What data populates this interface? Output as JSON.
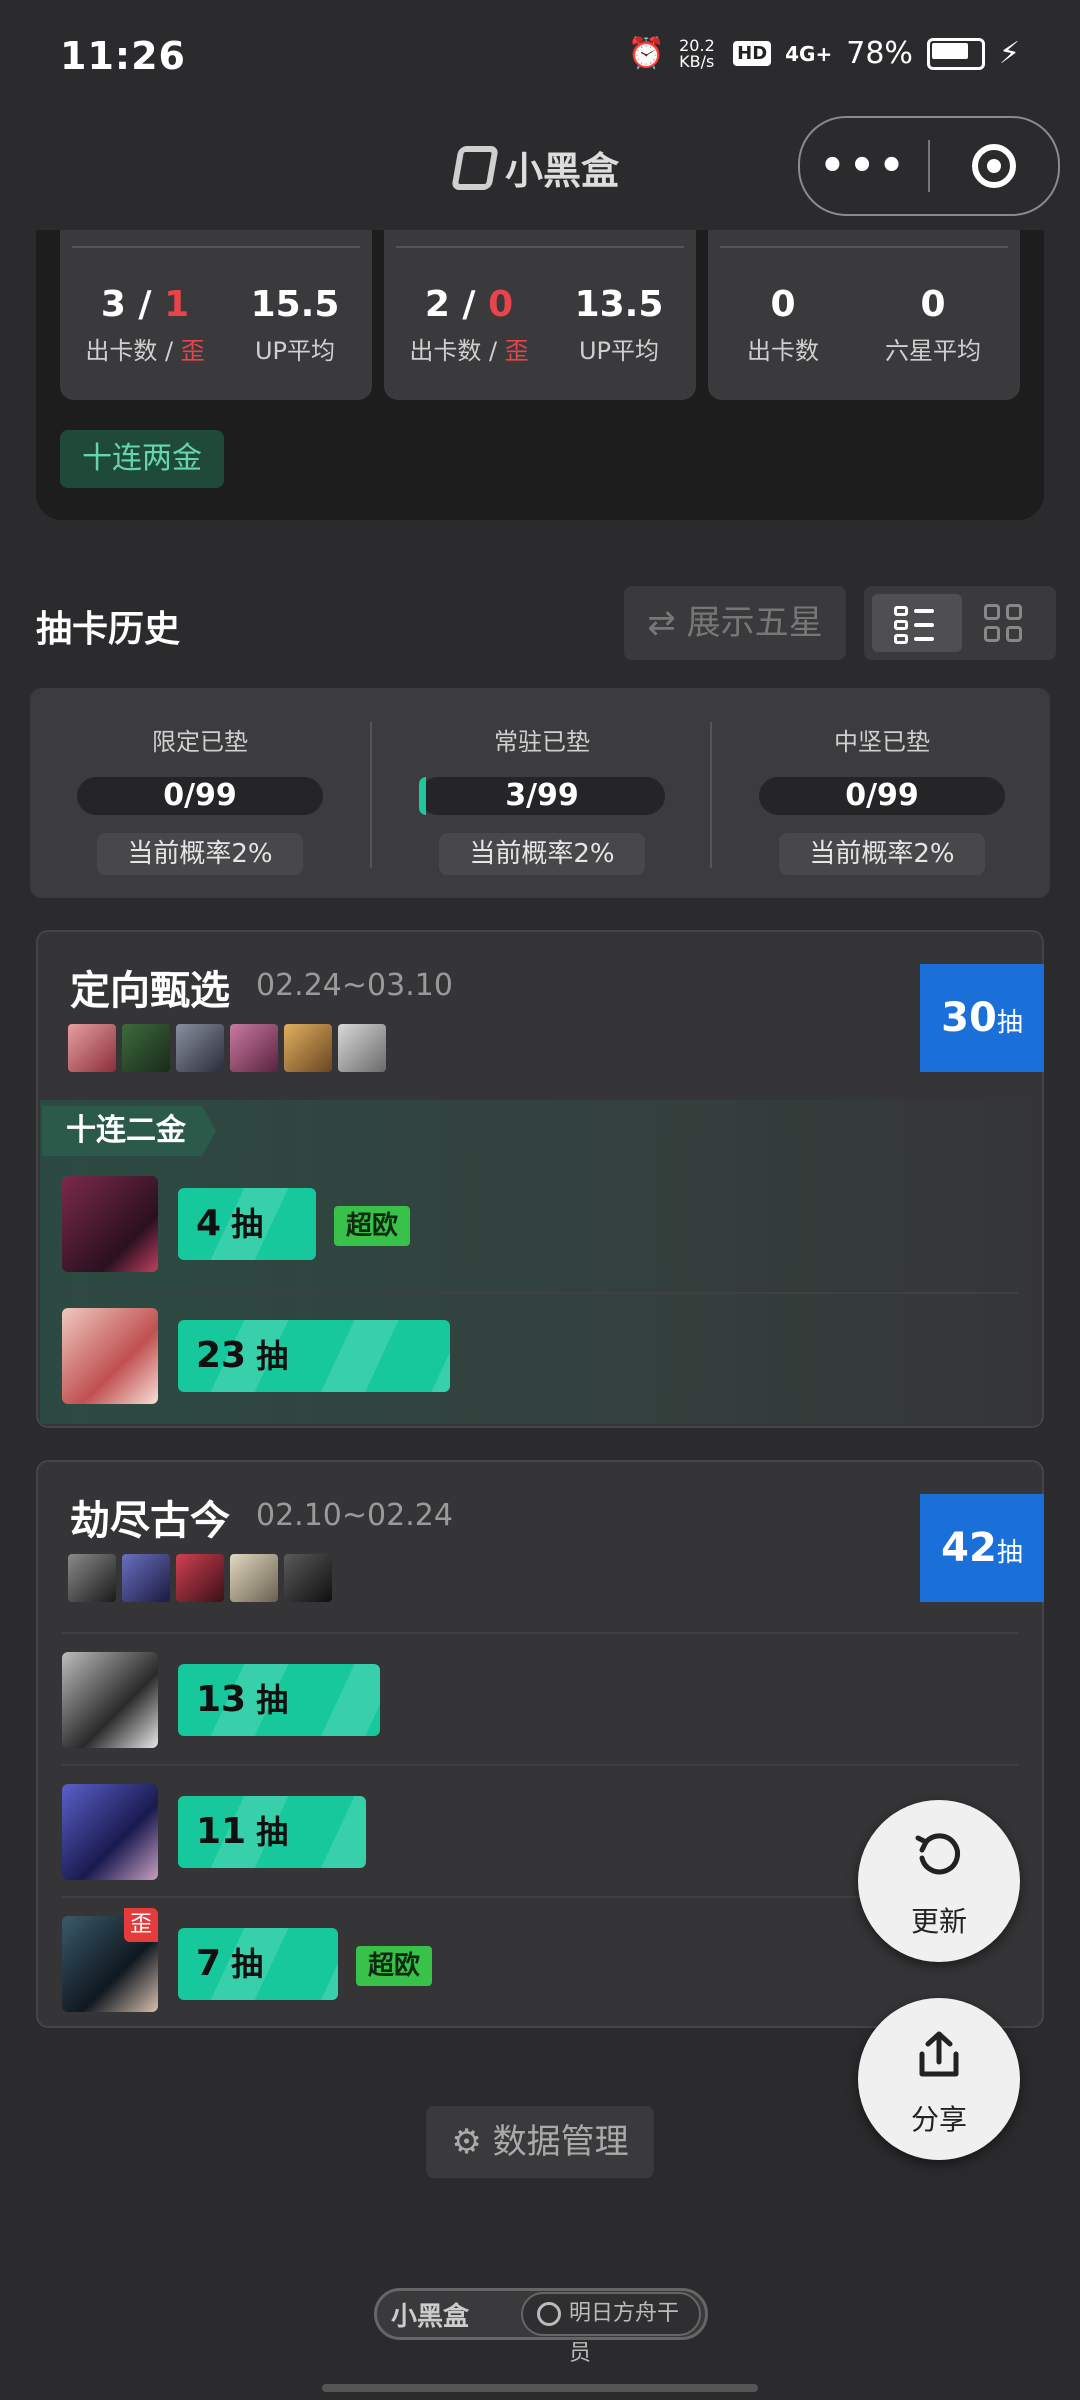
{
  "status_bar": {
    "time": "11:26",
    "net_speed": "20.2 KB/s",
    "hd": "HD",
    "network": "4G+",
    "battery": "78%"
  },
  "title_bar": {
    "brand": "小黑盒",
    "more": "•••"
  },
  "summary": {
    "cards": [
      {
        "a_val": "3",
        "a_red": "1",
        "a_lbl": "出卡数 / ",
        "a_lbl_red": "歪",
        "b_val": "15.5",
        "b_lbl": "UP平均"
      },
      {
        "a_val": "2",
        "a_red": "0",
        "a_lbl": "出卡数 / ",
        "a_lbl_red": "歪",
        "b_val": "13.5",
        "b_lbl": "UP平均"
      },
      {
        "a_val": "0",
        "a_lbl": "出卡数",
        "b_val": "0",
        "b_lbl": "六星平均"
      }
    ],
    "tag": "十连两金"
  },
  "history": {
    "title": "抽卡历史",
    "show_five_star": "⇄ 展示五星"
  },
  "pity": [
    {
      "title": "限定已垫",
      "value": "0/99",
      "progress": 0.0,
      "rate": "当前概率2%"
    },
    {
      "title": "常驻已垫",
      "value": "3/99",
      "progress": 0.03,
      "rate": "当前概率2%"
    },
    {
      "title": "中坚已垫",
      "value": "0/99",
      "progress": 0.0,
      "rate": "当前概率2%"
    }
  ],
  "banners": [
    {
      "name": "定向甄选",
      "date": "02.24~03.10",
      "count": "30",
      "unit": "抽",
      "ribbon": "十连二金",
      "pulls": [
        {
          "count": "4",
          "unit": "抽",
          "badge": "超欧"
        },
        {
          "count": "23",
          "unit": "抽"
        }
      ]
    },
    {
      "name": "劫尽古今",
      "date": "02.10~02.24",
      "count": "42",
      "unit": "抽",
      "pulls": [
        {
          "count": "13",
          "unit": "抽"
        },
        {
          "count": "11",
          "unit": "抽"
        },
        {
          "count": "7",
          "unit": "抽",
          "badge": "超欧",
          "off_banner": "歪"
        }
      ]
    }
  ],
  "fab": {
    "refresh": "更新",
    "share": "分享"
  },
  "footer": {
    "data_mgmt": "数据管理",
    "brand": "小黑盒",
    "search": "明日方舟干员"
  },
  "colors": {
    "accent_green": "#17c89c",
    "banner_blue": "#1a6fd8",
    "red": "#e8444a",
    "badge_green": "#39c24a"
  }
}
